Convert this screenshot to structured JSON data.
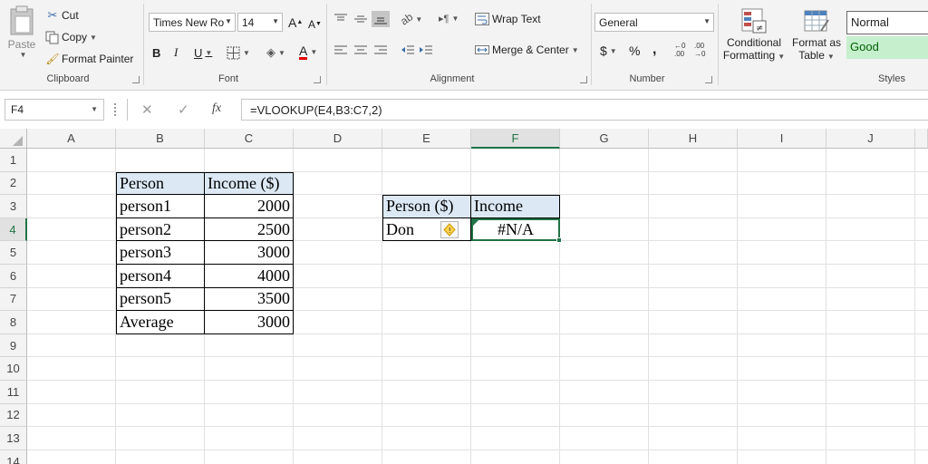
{
  "ribbon": {
    "clipboard": {
      "paste": "Paste",
      "cut": "Cut",
      "copy": "Copy",
      "format_painter": "Format Painter",
      "label": "Clipboard"
    },
    "font": {
      "name": "Times New Ro",
      "size": "14",
      "grow": "A",
      "shrink": "A",
      "bold": "B",
      "italic": "I",
      "underline": "U",
      "font_color_glyph": "A",
      "label": "Font"
    },
    "alignment": {
      "wrap_text": "Wrap Text",
      "merge_center": "Merge & Center",
      "label": "Alignment"
    },
    "number": {
      "format": "General",
      "currency": "$",
      "percent": "%",
      "comma": ",",
      "label": "Number"
    },
    "styles": {
      "conditional": "Conditional",
      "formatting": "Formatting",
      "format_as": "Format as",
      "table": "Table",
      "normal": "Normal",
      "good": "Good",
      "label": "Styles",
      "good_bg": "#c6efce",
      "good_fg": "#006100"
    }
  },
  "formula_bar": {
    "name_box": "F4",
    "cancel": "✕",
    "enter": "✓",
    "fx": "fx",
    "formula": "=VLOOKUP(E4,B3:C7,2)"
  },
  "grid": {
    "columns": [
      "A",
      "B",
      "C",
      "D",
      "E",
      "F",
      "G",
      "H",
      "I",
      "J"
    ],
    "rows": [
      "1",
      "2",
      "3",
      "4",
      "5",
      "6",
      "7",
      "8",
      "9",
      "10",
      "11",
      "12",
      "13",
      "14"
    ],
    "selected_column": "F",
    "selected_row": "4"
  },
  "table1": {
    "headers": [
      "Person",
      "Income ($)"
    ],
    "rows": [
      [
        "person1",
        "2000"
      ],
      [
        "person2",
        "2500"
      ],
      [
        "person3",
        "3000"
      ],
      [
        "person4",
        "4000"
      ],
      [
        "person5",
        "3500"
      ],
      [
        "Average",
        "3000"
      ]
    ]
  },
  "table2": {
    "headers": [
      "Person ($)",
      "Income"
    ],
    "person": "Don",
    "result": "#N/A",
    "warning_icon": "warning-diamond-icon"
  },
  "colors": {
    "accent": "#217346",
    "header_fill": "#dce9f5"
  }
}
